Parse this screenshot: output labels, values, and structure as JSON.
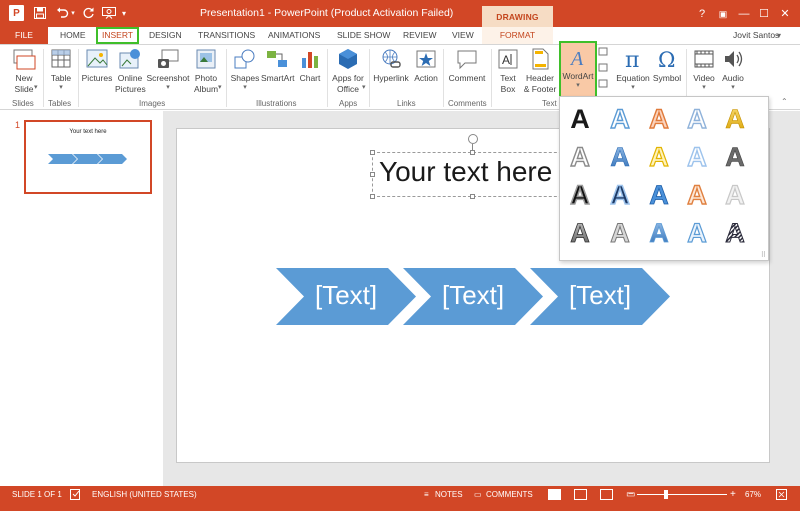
{
  "titlebar": {
    "logo_text": "P",
    "document_title": "Presentation1 - PowerPoint (Product Activation Failed)",
    "contextual_group": "DRAWING TOOLS",
    "help": "?",
    "ribbon_options": "▣",
    "minimize": "—",
    "maximize": "☐",
    "close": "✕"
  },
  "tabs": [
    "FILE",
    "HOME",
    "INSERT",
    "DESIGN",
    "TRANSITIONS",
    "ANIMATIONS",
    "SLIDE SHOW",
    "REVIEW",
    "VIEW",
    "FORMAT"
  ],
  "user": "Jovit Santos",
  "ribbon": {
    "buttons": {
      "new_slide": "New\nSlide",
      "table": "Table",
      "pictures": "Pictures",
      "online_pictures": "Online\nPictures",
      "screenshot": "Screenshot",
      "photo_album": "Photo\nAlbum",
      "shapes": "Shapes",
      "smartart": "SmartArt",
      "chart": "Chart",
      "apps": "Apps for\nOffice",
      "hyperlink": "Hyperlink",
      "action": "Action",
      "comment": "Comment",
      "text_box": "Text\nBox",
      "header_footer": "Header\n& Footer",
      "wordart": "WordArt",
      "equation": "Equation",
      "symbol": "Symbol",
      "video": "Video",
      "audio": "Audio"
    },
    "groups": [
      "Slides",
      "Tables",
      "Images",
      "Illustrations",
      "Apps",
      "Links",
      "Comments",
      "Text"
    ]
  },
  "thumbnail": {
    "number": "1",
    "title": "Your text here"
  },
  "slide": {
    "title": "Your text here",
    "process_items": [
      "[Text]",
      "[Text]",
      "[Text]"
    ]
  },
  "wordart_gallery": {
    "glyph": "A",
    "styles": [
      "black-plain",
      "blue-outline",
      "orange-outline",
      "blue-light-outline",
      "gold-gradient",
      "gray-outline",
      "blue-gradient",
      "gold-outline",
      "blue-pale-outline",
      "gray-dark",
      "black-shadow",
      "black-blue-fill",
      "blue-solid",
      "orange-gradient-outline",
      "gray-pale",
      "gray-bevel",
      "gray-light-bevel",
      "blue-bevel",
      "blue-pale-glow",
      "black-hatched"
    ]
  },
  "statusbar": {
    "slide_info": "SLIDE 1 OF 1",
    "language": "ENGLISH (UNITED STATES)",
    "notes": "NOTES",
    "comments": "COMMENTS",
    "zoom_out": "−",
    "zoom_in": "+",
    "zoom": "67%",
    "zoom_level_percent": 67
  },
  "colors": {
    "accent": "#d24726",
    "highlight": "#3fbf2a",
    "chevron": "#5b9bd5"
  }
}
